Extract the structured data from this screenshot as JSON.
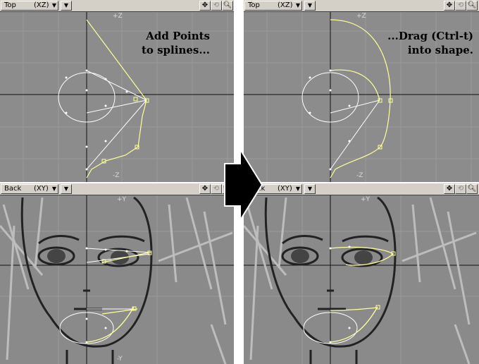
{
  "top_left": {
    "view_name": "Top",
    "axes": "(XZ)",
    "label_top": "+Z",
    "label_bottom": "-Z",
    "caption_line1": "Add Points",
    "caption_line2": "to splines..."
  },
  "top_right": {
    "view_name": "Top",
    "axes": "(XZ)",
    "label_top": "+Z",
    "label_bottom": "-Z",
    "caption_line1": "...Drag (Ctrl-t)",
    "caption_line2": "into shape."
  },
  "bottom_left": {
    "view_name": "Back",
    "axes": "(XY)",
    "label_top": "+Y",
    "label_bottom": "-Y"
  },
  "bottom_right": {
    "view_name": "Back",
    "axes": "(XY)",
    "label_top": "+Y"
  },
  "header_icons": [
    "move-icon",
    "rotate-icon",
    "zoom-icon"
  ],
  "colors": {
    "viewport_bg": "#8c8c8c",
    "header_bg": "#d4d0c8",
    "spline_selected": "#ffff99",
    "spline": "#ffffff",
    "arrow": "#000000"
  }
}
